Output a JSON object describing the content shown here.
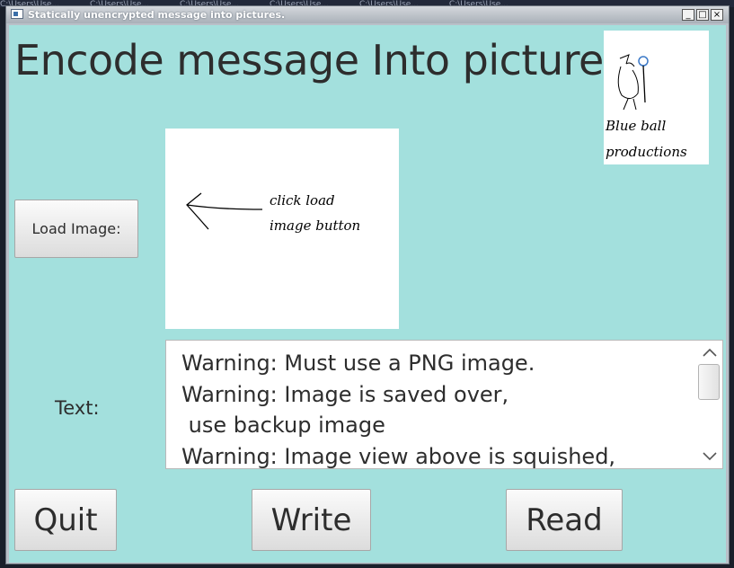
{
  "window": {
    "title": "Statically unencrypted message into pictures.",
    "controls": {
      "minimize": "_",
      "maximize": "□",
      "close": "×"
    }
  },
  "header": {
    "title": "Encode message Into picture"
  },
  "logo": {
    "line1": "Blue ball",
    "line2": "productions"
  },
  "load_button": {
    "label": "Load Image:"
  },
  "image_view": {
    "hint_line1": "click load",
    "hint_line2": "image button"
  },
  "text_label": "Text:",
  "textarea": {
    "lines": [
      "Warning: Must use a PNG image.",
      "Warning: Image is saved over,",
      " use backup image",
      "Warning: Image view above is squished,"
    ]
  },
  "buttons": {
    "quit": "Quit",
    "write": "Write",
    "read": "Read"
  },
  "colors": {
    "panel_background": "#a3e0dd",
    "button_face": "#e8e8e8"
  },
  "icons": {
    "app": "app-window-icon",
    "scroll_up": "chevron-up-icon",
    "scroll_down": "chevron-down-icon",
    "arrow": "left-arrow-icon",
    "logo_figure": "wizard-figure-icon"
  }
}
